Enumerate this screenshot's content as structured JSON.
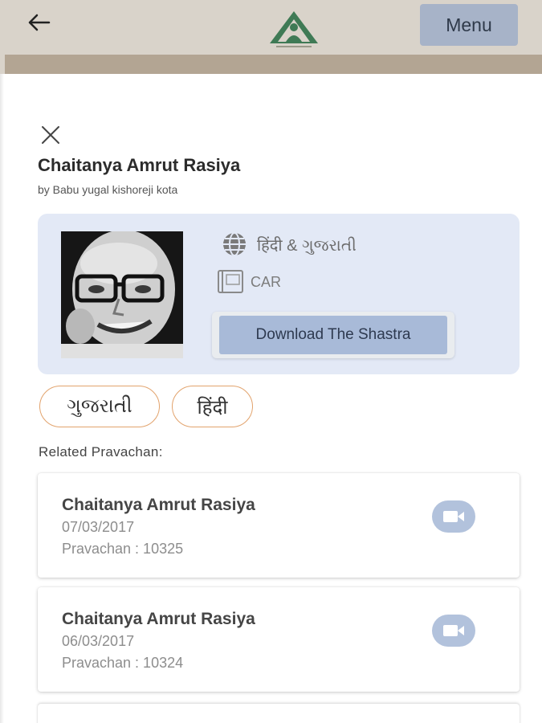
{
  "header": {
    "menu_label": "Menu",
    "colors": {
      "bar": "#d9d3ca",
      "strip": "#b3a593",
      "menu_bg": "#a7b3c8"
    }
  },
  "book": {
    "title": "Chaitanya Amrut Rasiya",
    "author": "by Babu yugal kishoreji kota",
    "languages": "हिंदी & ગુજરાતી",
    "code": "CAR",
    "download_label": "Download The Shastra"
  },
  "language_chips": [
    "ગુજરાતી",
    "हिंदी"
  ],
  "related": {
    "heading": "Related Pravachan:",
    "items": [
      {
        "title": "Chaitanya Amrut Rasiya",
        "date": "07/03/2017",
        "number": "Pravachan : 10325"
      },
      {
        "title": "Chaitanya Amrut Rasiya",
        "date": "06/03/2017",
        "number": "Pravachan : 10324"
      }
    ]
  },
  "icons": {
    "back": "arrow-left-icon",
    "logo": "temple-logo-icon",
    "close": "close-icon",
    "language": "globe-icon",
    "code": "book-icon",
    "video": "video-camera-icon"
  }
}
